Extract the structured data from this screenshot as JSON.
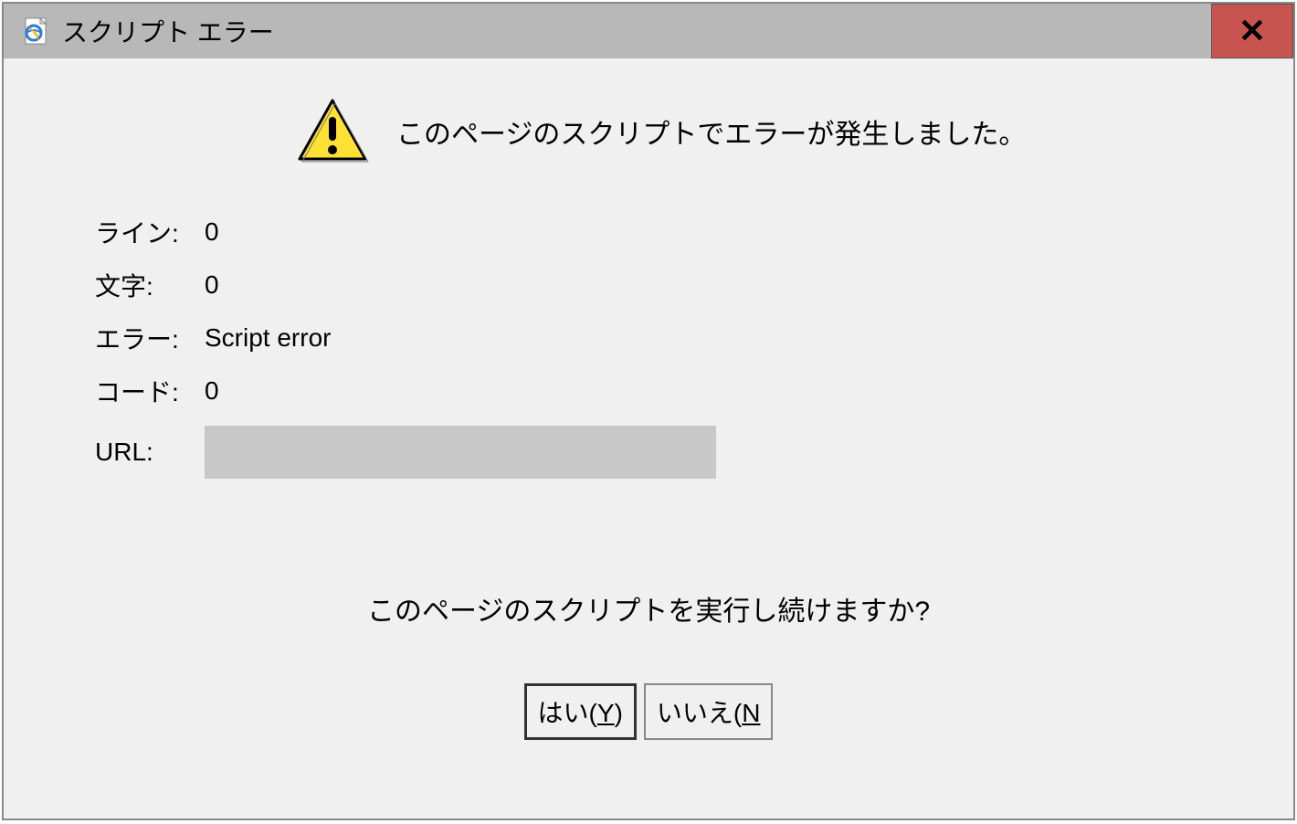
{
  "titlebar": {
    "title": "スクリプト エラー",
    "close_label": "✕"
  },
  "header": {
    "message": "このページのスクリプトでエラーが発生しました。"
  },
  "details": {
    "line_label": "ライン:",
    "line_value": "0",
    "char_label": "文字:",
    "char_value": "0",
    "error_label": "エラー:",
    "error_value": "Script error",
    "code_label": "コード:",
    "code_value": "0",
    "url_label": "URL:",
    "url_value": ""
  },
  "prompt": {
    "text": "このページのスクリプトを実行し続けますか?"
  },
  "buttons": {
    "yes_prefix": "はい(",
    "yes_key": "Y",
    "yes_suffix": ")",
    "no_prefix": "いいえ(",
    "no_key": "N",
    "no_suffix": ""
  }
}
